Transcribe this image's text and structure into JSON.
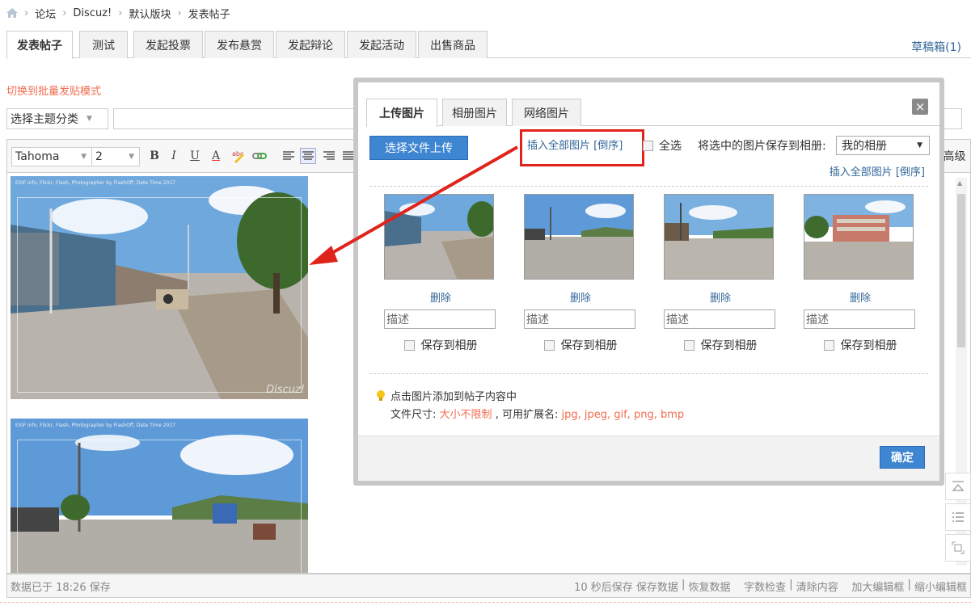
{
  "breadcrumb": {
    "items": [
      "论坛",
      "Discuz!",
      "默认版块",
      "发表帖子"
    ]
  },
  "tabs": [
    "发表帖子",
    "测试",
    "发起投票",
    "发布悬赏",
    "发起辩论",
    "发起活动",
    "出售商品"
  ],
  "drafts": "草稿箱(1)",
  "switch_mode": "切换到批量发贴模式",
  "category_select": "选择主题分类",
  "toolbar": {
    "font": "Tahoma",
    "size": "2",
    "bold": "B",
    "italic": "I",
    "underline": "U",
    "color": "A",
    "advanced": "高级"
  },
  "editor": {
    "photo_exif": "EXIF info, Flickr, Flash, Photographer by FlashOff, Date Time 2017",
    "watermark": "Discuz!"
  },
  "status": {
    "saved": "数据已于 18:26 保存",
    "actions": [
      "10 秒后保存 保存数据",
      "恢复数据",
      "字数检查",
      "清除内容",
      "加大编辑框",
      "缩小编辑框"
    ]
  },
  "modal": {
    "tabs": [
      "上传图片",
      "相册图片",
      "网络图片"
    ],
    "upload_button": "选择文件上传",
    "insert_all_reverse": "插入全部图片 [倒序]",
    "select_all": "全选",
    "save_to_album_label": "将选中的图片保存到相册:",
    "album": "我的相册",
    "insert_all": "插入全部图片 [倒序]",
    "images": [
      {
        "delete": "删除",
        "desc": "描述",
        "save": "保存到相册"
      },
      {
        "delete": "删除",
        "desc": "描述",
        "save": "保存到相册"
      },
      {
        "delete": "删除",
        "desc": "描述",
        "save": "保存到相册"
      },
      {
        "delete": "删除",
        "desc": "描述",
        "save": "保存到相册"
      }
    ],
    "tip": "点击图片添加到帖子内容中",
    "filesize_label": "文件尺寸:",
    "filesize_value": "大小不限制",
    "ext_label": ", 可用扩展名:",
    "ext_value": "jpg, jpeg, gif, png, bmp",
    "ok": "确定"
  },
  "colors": {
    "link": "#336699",
    "accent": "#f26c4f",
    "button": "#3e86d2",
    "annotation": "#e0241b"
  }
}
